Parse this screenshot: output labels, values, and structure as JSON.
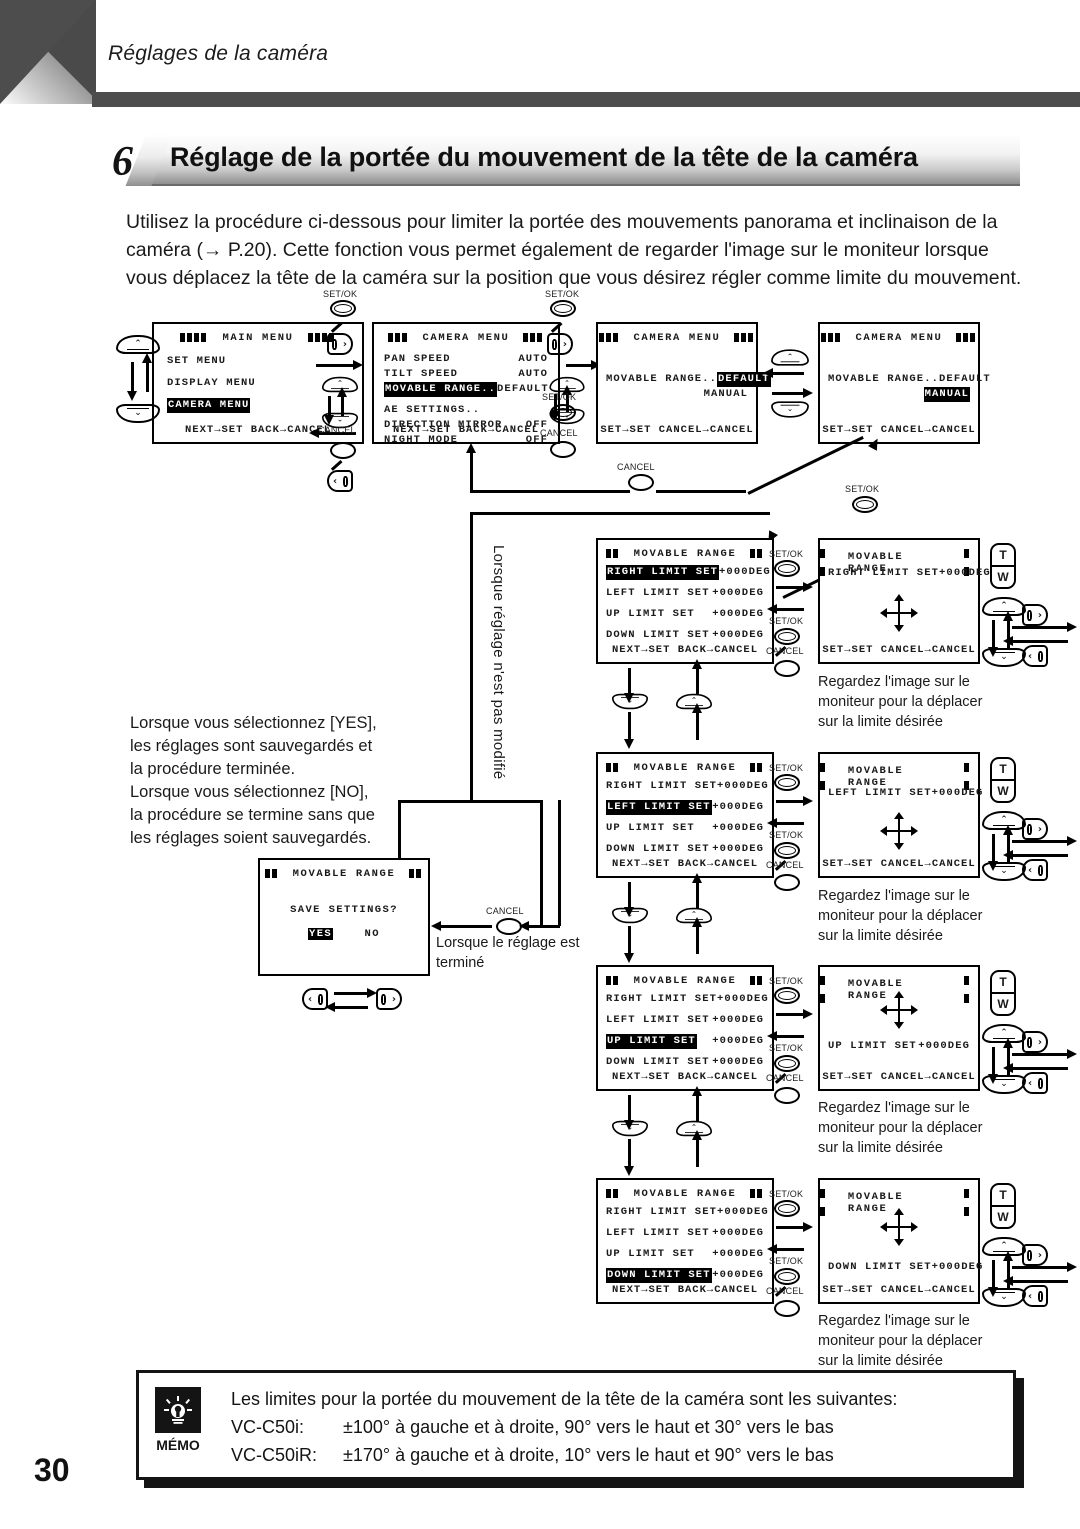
{
  "header": {
    "running_head": "Réglages de la caméra",
    "section_number": "6",
    "section_title": "Réglage de la portée du mouvement de la tête de la caméra"
  },
  "intro": "Utilisez la procédure ci-dessous pour limiter la portée des mouvements panorama et inclinaison de la caméra (→ P.20). Cette fonction vous permet également de regarder l'image sur le moniteur lorsque vous déplacez la tête de la caméra sur la position que vous désirez régler comme limite du mouvement.",
  "notes": {
    "yes_no": "Lorsque vous sélectionnez [YES], les réglages sont sauvegardés et la procédure terminée.\nLorsque vous sélectionnez [NO], la procédure se termine sans que les réglages soient sauvegardés.",
    "yes_no_l1": "Lorsque vous sélectionnez [YES],",
    "yes_no_l2": "les réglages sont sauvegardés et",
    "yes_no_l3": "la procédure terminée.",
    "yes_no_l4": "Lorsque vous sélectionnez [NO],",
    "yes_no_l5": "la procédure se termine sans que",
    "yes_no_l6": "les réglages soient sauvegardés.",
    "unchanged_vertical": "Lorsque réglage n'est pas modifié",
    "when_done_l1": "Lorsque le réglage est",
    "when_done_l2": "terminé",
    "monitor_l1": "Regardez l'image sur le",
    "monitor_l2": "moniteur pour la déplacer",
    "monitor_l3": "sur la limite désirée"
  },
  "buttons": {
    "set_ok": "SET/OK",
    "cancel": "CANCEL",
    "zoom_t": "T",
    "zoom_w": "W"
  },
  "screens": {
    "main_menu": {
      "title": "MAIN MENU",
      "rows": [
        {
          "label": "SET MENU",
          "value": "",
          "highlight": false
        },
        {
          "label": "DISPLAY MENU",
          "value": "",
          "highlight": false
        },
        {
          "label": "CAMERA MENU",
          "value": "",
          "highlight": true
        }
      ],
      "footer": "NEXT→SET   BACK→CANCEL"
    },
    "camera_menu": {
      "title": "CAMERA MENU",
      "rows_top": [
        {
          "label": "PAN  SPEED",
          "value": "AUTO",
          "highlight": false
        },
        {
          "label": "TILT SPEED",
          "value": "AUTO",
          "highlight": false
        },
        {
          "label": "MOVABLE RANGE..",
          "value": "DEFAULT",
          "highlight": true
        }
      ],
      "rows_bottom": [
        {
          "label": "AE SETTINGS..",
          "value": "",
          "highlight": false
        },
        {
          "label": "DIRECTION MIRROR",
          "value": "OFF",
          "highlight": false
        },
        {
          "label": "NIGHT MODE",
          "value": "OFF",
          "highlight": false
        }
      ],
      "footer": "NEXT→SET   BACK→CANCEL"
    },
    "range_default": {
      "title": "CAMERA MENU",
      "label": "MOVABLE RANGE..",
      "opt1": "DEFAULT",
      "opt2": "MANUAL",
      "selected": "DEFAULT",
      "footer": "SET→SET CANCEL→CANCEL"
    },
    "range_manual": {
      "title": "CAMERA MENU",
      "label": "MOVABLE RANGE..",
      "opt1": "DEFAULT",
      "opt2": "MANUAL",
      "selected": "MANUAL",
      "footer": "SET→SET CANCEL→CANCEL"
    },
    "movable_list_right": {
      "title": "MOVABLE RANGE",
      "rows": [
        {
          "label": "RIGHT LIMIT SET",
          "value": "+000DEG",
          "highlight": true
        },
        {
          "label": "LEFT LIMIT SET",
          "value": "+000DEG",
          "highlight": false
        },
        {
          "label": "UP LIMIT SET",
          "value": "+000DEG",
          "highlight": false
        },
        {
          "label": "DOWN LIMIT SET",
          "value": "+000DEG",
          "highlight": false
        }
      ],
      "footer": "NEXT→SET   BACK→CANCEL"
    },
    "movable_list_left": {
      "title": "MOVABLE RANGE",
      "rows": [
        {
          "label": "RIGHT LIMIT SET",
          "value": "+000DEG",
          "highlight": false
        },
        {
          "label": "LEFT LIMIT SET",
          "value": "+000DEG",
          "highlight": true
        },
        {
          "label": "UP LIMIT SET",
          "value": "+000DEG",
          "highlight": false
        },
        {
          "label": "DOWN LIMIT SET",
          "value": "+000DEG",
          "highlight": false
        }
      ],
      "footer": "NEXT→SET   BACK→CANCEL"
    },
    "movable_list_up": {
      "title": "MOVABLE RANGE",
      "rows": [
        {
          "label": "RIGHT LIMIT SET",
          "value": "+000DEG",
          "highlight": false
        },
        {
          "label": "LEFT LIMIT SET",
          "value": "+000DEG",
          "highlight": false
        },
        {
          "label": "UP LIMIT SET",
          "value": "+000DEG",
          "highlight": true
        },
        {
          "label": "DOWN LIMIT SET",
          "value": "+000DEG",
          "highlight": false
        }
      ],
      "footer": "NEXT→SET   BACK→CANCEL"
    },
    "movable_list_down": {
      "title": "MOVABLE RANGE",
      "rows": [
        {
          "label": "RIGHT LIMIT SET",
          "value": "+000DEG",
          "highlight": false
        },
        {
          "label": "LEFT LIMIT SET",
          "value": "+000DEG",
          "highlight": false
        },
        {
          "label": "UP LIMIT SET",
          "value": "+000DEG",
          "highlight": false
        },
        {
          "label": "DOWN LIMIT SET",
          "value": "+000DEG",
          "highlight": true
        }
      ],
      "footer": "NEXT→SET   BACK→CANCEL"
    },
    "adjust_right": {
      "title": "MOVABLE RANGE",
      "label": "RIGHT LIMIT SET",
      "value": "+000DEG",
      "footer": "SET→SET CANCEL→CANCEL",
      "label_position": "top"
    },
    "adjust_left": {
      "title": "MOVABLE RANGE",
      "label": "LEFT LIMIT SET",
      "value": "+000DEG",
      "footer": "SET→SET CANCEL→CANCEL",
      "label_position": "top"
    },
    "adjust_up": {
      "title": "MOVABLE RANGE",
      "label": "UP LIMIT SET",
      "value": "+000DEG",
      "footer": "SET→SET CANCEL→CANCEL",
      "label_position": "bottom"
    },
    "adjust_down": {
      "title": "MOVABLE RANGE",
      "label": "DOWN LIMIT SET",
      "value": "+000DEG",
      "footer": "SET→SET CANCEL→CANCEL",
      "label_position": "bottom"
    },
    "save": {
      "title": "MOVABLE RANGE",
      "prompt": "SAVE SETTINGS?",
      "yes": "YES",
      "no": "NO",
      "selected": "YES"
    }
  },
  "memo": {
    "label": "MÉMO",
    "line1": "Les limites pour la portée du mouvement de la tête de la caméra sont les suivantes:",
    "model1": "VC-C50i:",
    "model1_spec": "±100° à gauche et à droite, 90° vers le haut et 30° vers le bas",
    "model2": "VC-C50iR:",
    "model2_spec": "±170° à gauche et à droite, 10° vers le haut et 90° vers le bas"
  },
  "page_number": "30"
}
